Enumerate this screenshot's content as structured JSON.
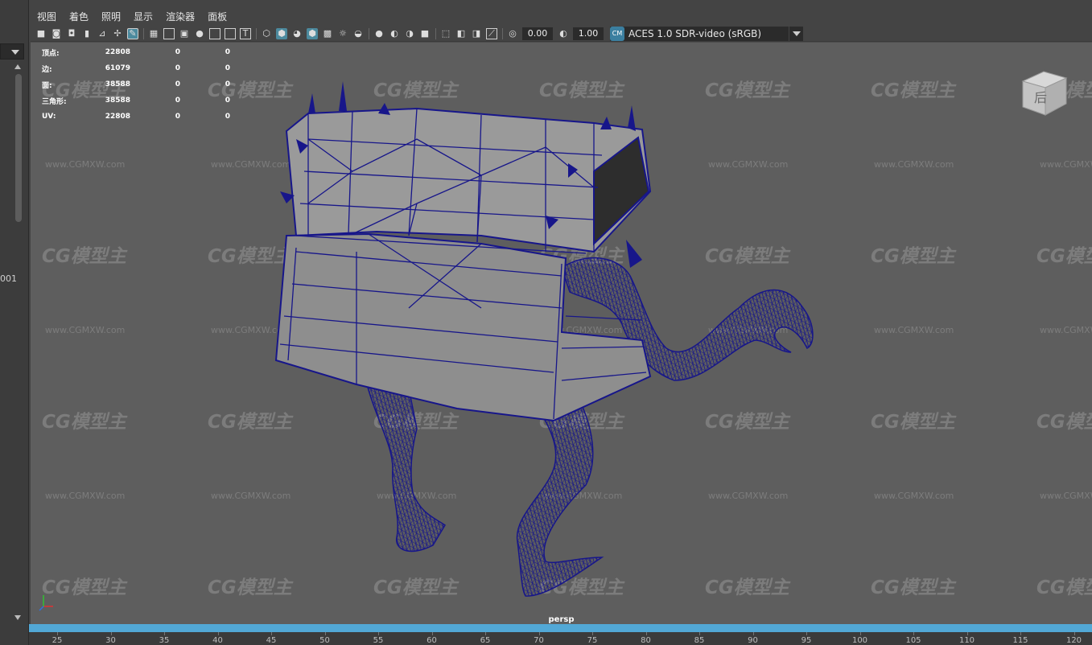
{
  "menu": [
    "视图",
    "着色",
    "照明",
    "显示",
    "渲染器",
    "面板"
  ],
  "toolbar": {
    "field_a": "0.00",
    "field_b": "1.00",
    "color_management": "ACES 1.0 SDR-video (sRGB)"
  },
  "hud": {
    "rows": [
      {
        "label": "顶点:",
        "value": "22808",
        "sel": "0",
        "comp": "0"
      },
      {
        "label": "边:",
        "value": "61079",
        "sel": "0",
        "comp": "0"
      },
      {
        "label": "面:",
        "value": "38588",
        "sel": "0",
        "comp": "0"
      },
      {
        "label": "三角形:",
        "value": "38588",
        "sel": "0",
        "comp": "0"
      },
      {
        "label": "UV:",
        "value": "22808",
        "sel": "0",
        "comp": "0"
      }
    ]
  },
  "viewcube_label": "后",
  "camera_label": "persp",
  "left_item": "001",
  "watermark": {
    "brand": "CG模型主",
    "url": "www.CGMXW.com"
  },
  "ruler_ticks": [
    "25",
    "30",
    "35",
    "40",
    "45",
    "50",
    "55",
    "60",
    "65",
    "70",
    "75",
    "80",
    "85",
    "90",
    "95",
    "100",
    "105",
    "110",
    "115",
    "120"
  ],
  "colors": {
    "wireframe": "#17168a",
    "mesh_fill": "#9a9a9a",
    "viewport_bg": "#5e5e5e",
    "timeline": "#52a8d6"
  }
}
